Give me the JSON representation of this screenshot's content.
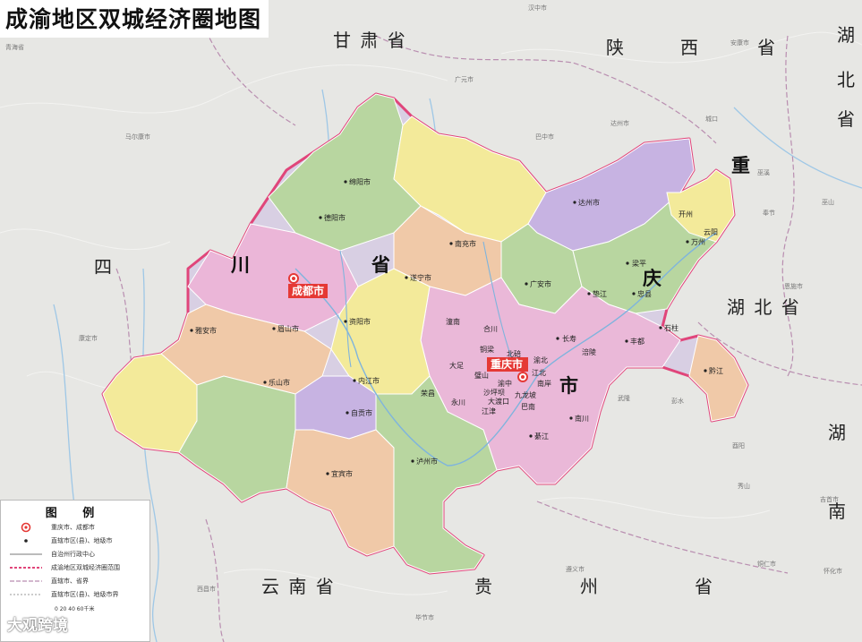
{
  "title": "成渝地区双城经济圈地图",
  "provinces": {
    "gansu": "甘 肃 省",
    "shaanxi_1": "陕",
    "shaanxi_2": "西",
    "shaanxi_3": "省",
    "hubei_top_1": "湖",
    "hubei_top_2": "北",
    "hubei_top_3": "省",
    "sichuan_1": "四",
    "sichuan_2": "川",
    "sichuan_3": "省",
    "chongqing_1": "重",
    "chongqing_2": "庆",
    "chongqing_3": "市",
    "hubei_mid": "湖 北 省",
    "hunan_1": "湖",
    "hunan_2": "南",
    "yunnan": "云 南 省",
    "guizhou_1": "贵",
    "guizhou_2": "州",
    "guizhou_3": "省"
  },
  "highlights": {
    "chengdu": "成都市",
    "chongqing": "重庆市"
  },
  "cities_in": [
    "绵阳市",
    "德阳市",
    "南充市",
    "广安市",
    "达州市",
    "遂宁市",
    "资阳市",
    "眉山市",
    "雅安市",
    "乐山市",
    "内江市",
    "自贡市",
    "宜宾市",
    "泸州市",
    "潼南",
    "合川",
    "铜梁",
    "大足",
    "北碚",
    "渝北",
    "长寿",
    "涪陵",
    "璧山",
    "江北",
    "南岸",
    "渝中",
    "沙坪坝",
    "大渡口",
    "九龙坡",
    "巴南",
    "荣昌",
    "永川",
    "江津",
    "綦江",
    "南川",
    "梁平",
    "垫江",
    "忠县",
    "丰都",
    "石柱",
    "开州",
    "云阳",
    "万州",
    "黔江"
  ],
  "cities_out": [
    "汉中市",
    "安康市",
    "广元市",
    "巴中市",
    "城口",
    "巫溪",
    "巫山",
    "奉节",
    "恩施市",
    "酉阳",
    "秀山",
    "武隆",
    "彭水",
    "遵义市",
    "毕节市",
    "铜仁市",
    "怀化市",
    "吉首市",
    "青海省",
    "马尔康市",
    "康定市",
    "西昌市",
    "达州市"
  ],
  "legend": {
    "title": "图 例",
    "items": [
      "重庆市、成都市",
      "直辖市区(县)、地级市",
      "自治州行政中心",
      "成渝地区双城经济圈范围",
      "直辖市、省界",
      "直辖市区(县)、地级市界"
    ],
    "scale": "0   20   40   60千米"
  },
  "watermark": "大观跨境"
}
